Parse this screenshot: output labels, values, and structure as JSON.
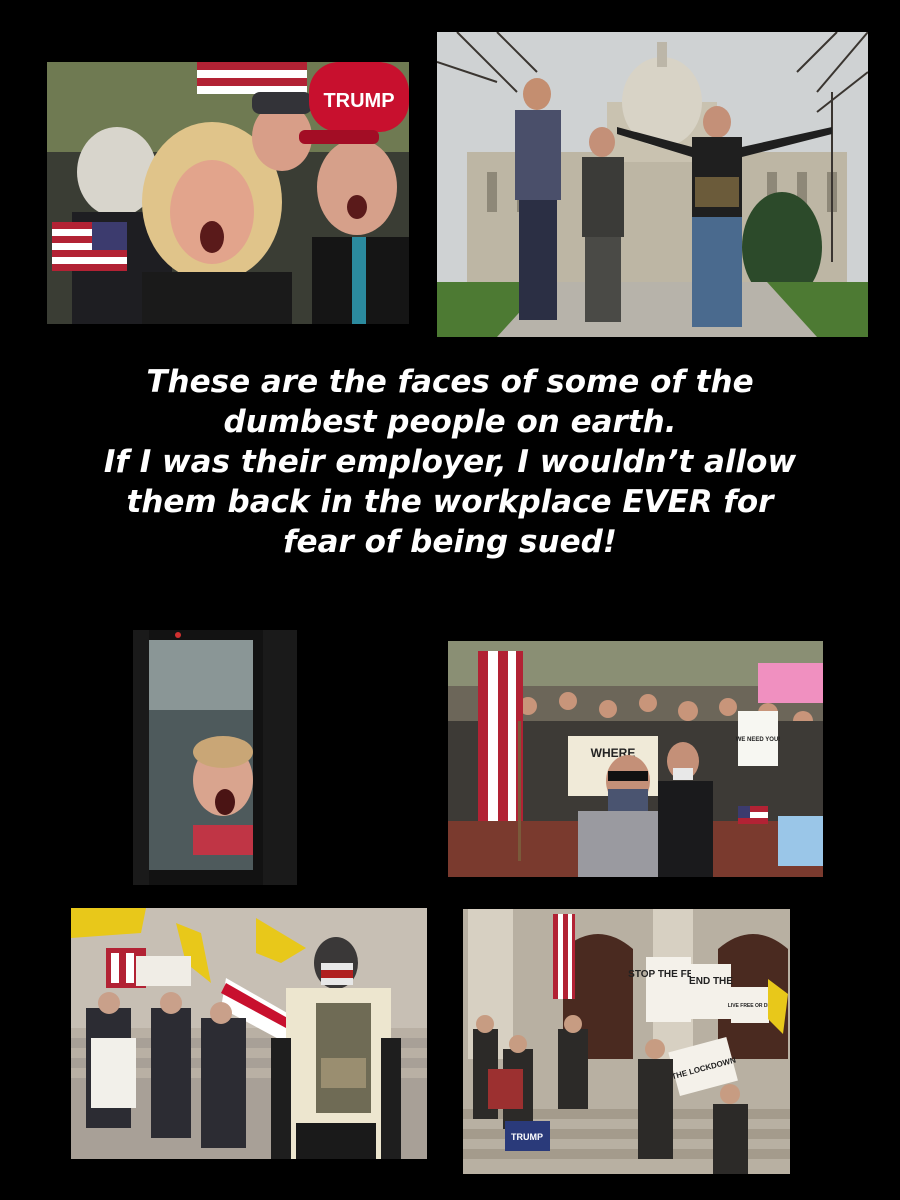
{
  "caption": {
    "lines": [
      "These are the faces of some of the",
      "dumbest people on earth.",
      "If I was their employer, I wouldn’t allow",
      "them back in the workplace EVER for",
      "fear of being sued!"
    ]
  },
  "photos": {
    "top_left": {
      "hat_text": "TRUMP"
    },
    "bottom_middle_right": {
      "sign_text_1": "WHERE",
      "sign_text_2": "WE NEED YOU!"
    },
    "bottom_right": {
      "sign_stop": "STOP THE FEAR",
      "sign_end": "END THE",
      "sign_live": "LIVE FREE OR DIE",
      "sign_lockdown": "THE LOCKDOWN",
      "sign_trump": "TRUMP"
    }
  },
  "colors": {
    "background": "#000000",
    "caption_text": "#ffffff",
    "flag_red": "#b22234",
    "flag_blue": "#3c3b6e",
    "trump_hat_red": "#c8102e",
    "gadsden_yellow": "#e8c81a"
  }
}
